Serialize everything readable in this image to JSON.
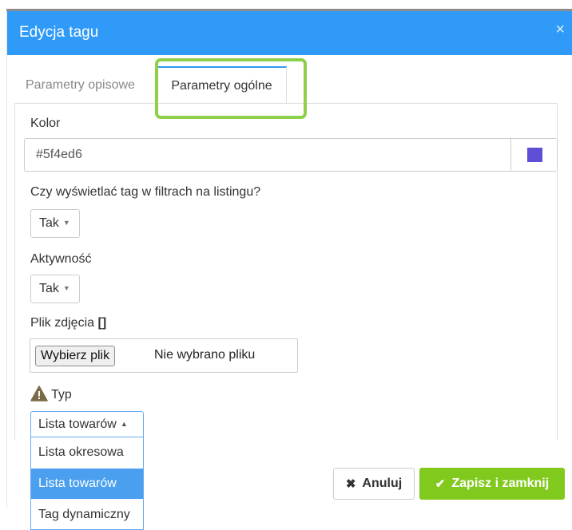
{
  "dialog": {
    "title": "Edycja tagu",
    "close_glyph": "×"
  },
  "tabs": [
    {
      "label": "Parametry opisowe",
      "active": false
    },
    {
      "label": "Parametry ogólne",
      "active": true
    }
  ],
  "form": {
    "color": {
      "label": "Kolor",
      "value": "#5f4ed6",
      "swatch_color": "#5f4ed6"
    },
    "show_in_filters": {
      "label": "Czy wyświetlać tag w filtrach na listingu?",
      "value": "Tak"
    },
    "activity": {
      "label": "Aktywność",
      "value": "Tak"
    },
    "image_file": {
      "label": "Plik zdjęcia",
      "label_suffix": "[]",
      "button_label": "Wybierz plik",
      "status": "Nie wybrano pliku"
    },
    "type": {
      "label": "Typ",
      "warning_icon": "warning-triangle-icon",
      "selected": "Lista towarów",
      "options": [
        "Lista okresowa",
        "Lista towarów",
        "Tag dynamiczny"
      ]
    }
  },
  "footer": {
    "cancel_label": "Anuluj",
    "save_label": "Zapisz i zamknij"
  },
  "colors": {
    "header": "#2f9af7",
    "highlight": "#8fd04a",
    "save_button": "#82c91e",
    "selected_option": "#4a9fee"
  }
}
